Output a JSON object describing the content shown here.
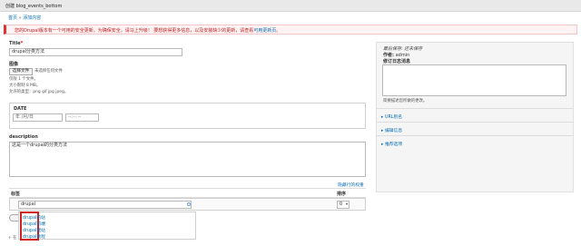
{
  "window": {
    "title": "创建 blog_events_bottom"
  },
  "breadcrumb": {
    "home": "首页",
    "separator": "»",
    "current": "添加内容"
  },
  "message": {
    "text": "您的Drupal版本有一个可用的安全更新。为确保安全，请马上升级！ 要想获得更多信息，以及安装缺少的更新，请查看",
    "link": "可用更新页"
  },
  "form": {
    "title_label": "Title",
    "required_mark": "*",
    "title_value": "drupal分类方法",
    "image_label": "图像",
    "image_button": "选择文件",
    "image_status": "未选择任何文件",
    "image_help": [
      "仅限 1 个文件。",
      "大小限制 8 MB。",
      "允许的类型：png gif jpg jpeg。"
    ],
    "date_legend": "DATE",
    "date_placeholder": "年 /月/日",
    "time_placeholder": "--:--:--",
    "description_label": "description",
    "description_value": "这是一个drupal的分类方法",
    "weights_toggle": "隐藏行的权重",
    "tags_header": "标签",
    "order_header": "排序",
    "tag_value": "drupal",
    "order_value": "0",
    "autocomplete": [
      "drupal的站",
      "drupal前端",
      "drupal建站",
      "drupal教程"
    ],
    "partial_text": "+ 在"
  },
  "sidebar": {
    "saved_label": "最后保存: 还未保存",
    "author_label": "作者:",
    "author_value": "admin",
    "revision_label": "修订日志消息",
    "revision_help": "简要描述您所做的更改。",
    "sections": [
      "URL别名",
      "编辑信息",
      "推荐选项"
    ]
  },
  "colors": {
    "link": "#0a6fb5",
    "error": "#d33",
    "highlight": "#d02020"
  }
}
